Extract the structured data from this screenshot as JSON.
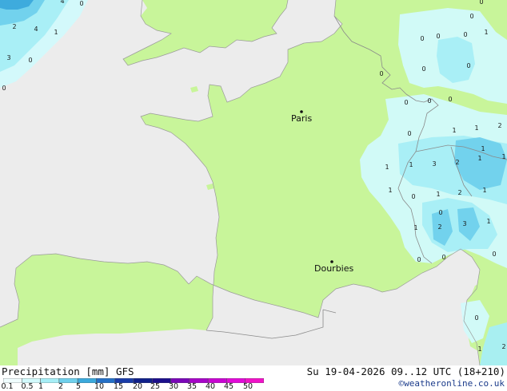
{
  "map": {
    "cities": [
      {
        "name": "Paris"
      },
      {
        "name": "Dourbies"
      }
    ],
    "values": [
      "4",
      "0",
      "2",
      "4",
      "1",
      "3",
      "0",
      "0",
      "0",
      "0",
      "0",
      "0",
      "0",
      "1",
      "0",
      "0",
      "0",
      "0",
      "0",
      "0",
      "1",
      "1",
      "2",
      "0",
      "1",
      "1",
      "1",
      "1",
      "3",
      "2",
      "1",
      "0",
      "1",
      "1",
      "2",
      "1",
      "0",
      "2",
      "3",
      "1",
      "1",
      "0",
      "0",
      "0",
      "0",
      "1",
      "2"
    ],
    "colors": {
      "land": "#c8f59a",
      "sea": "#ececec",
      "precip_light": "#d2fafc",
      "precip_mid": "#a6eef6",
      "precip_strong": "#6fd0ec",
      "precip_heavy": "#3ba9dc"
    }
  },
  "footer": {
    "title": "Precipitation [mm] GFS",
    "datetime": "Su 19-04-2026 09..12 UTC (18+210)",
    "credit": "©weatheronline.co.uk",
    "scale_labels": [
      "0.1",
      "0.5",
      "1",
      "2",
      "5",
      "10",
      "15",
      "20",
      "25",
      "30",
      "35",
      "40",
      "45",
      "50"
    ],
    "scale_colors": [
      "#f0fdfe",
      "#d2fafc",
      "#a6eef6",
      "#6fd0ec",
      "#3ba9dc",
      "#2470c6",
      "#1a3ca8",
      "#10208a",
      "#1c0f8c",
      "#7a07b8",
      "#a605c8",
      "#c805d2",
      "#e20ad8",
      "#f012c8"
    ]
  }
}
